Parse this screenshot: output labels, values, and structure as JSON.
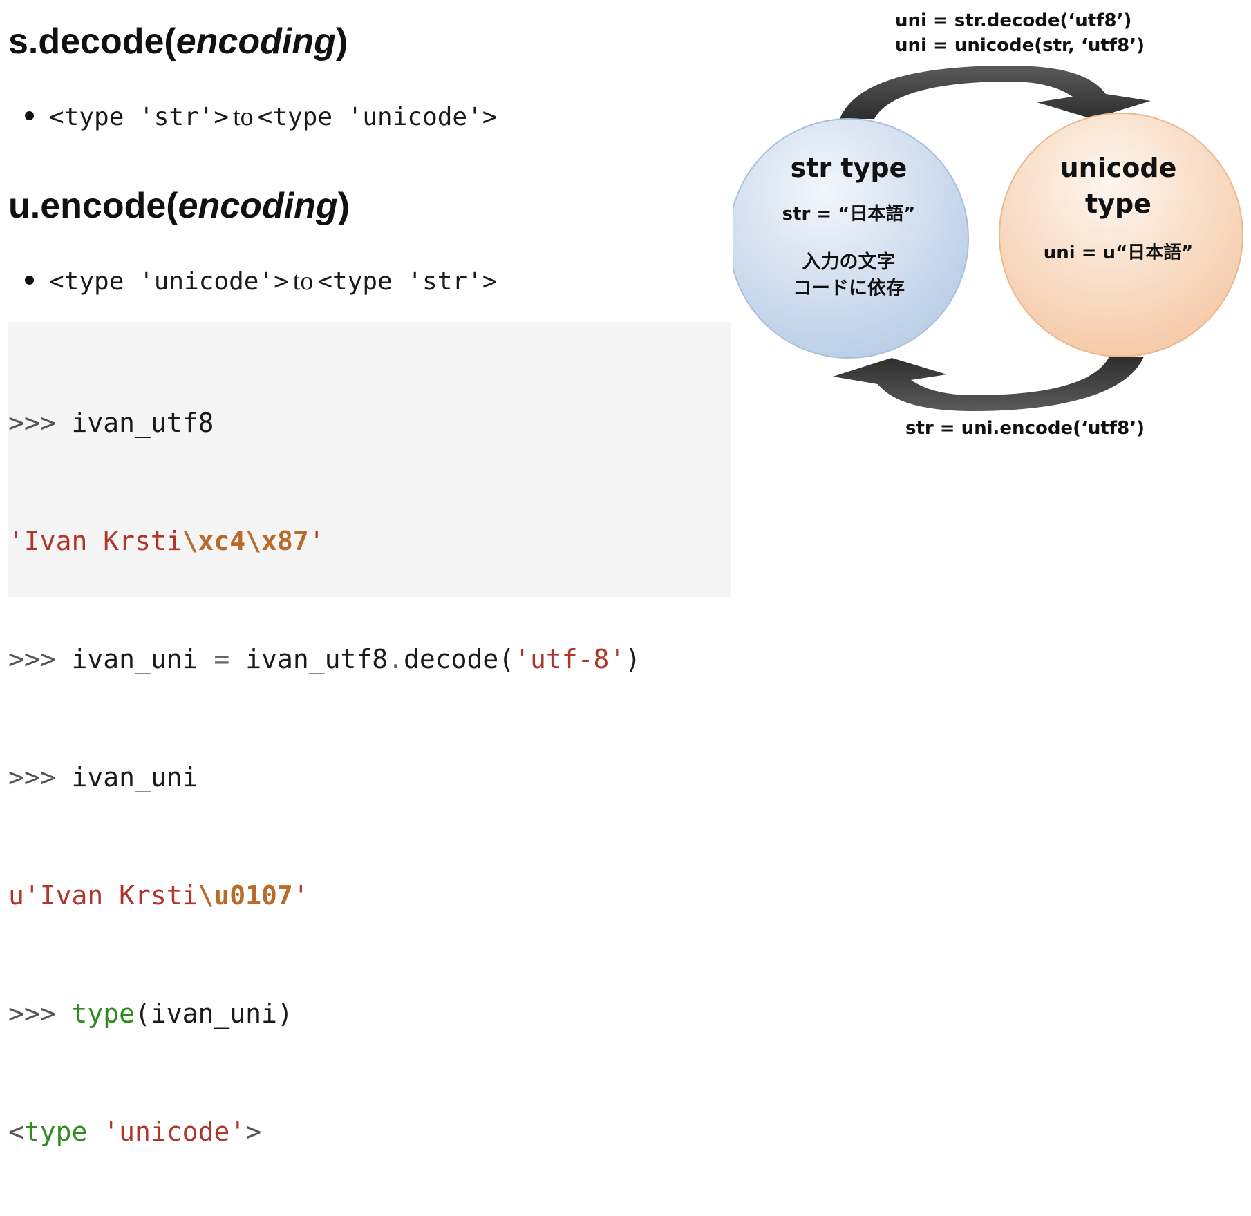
{
  "left": {
    "heading1": {
      "prefix": "s.decode(",
      "param": "encoding",
      "suffix": ")"
    },
    "bullet1": {
      "from": "<type 'str'>",
      "word": "to",
      "to": "<type 'unicode'>"
    },
    "heading2": {
      "prefix": "u.encode(",
      "param": "encoding",
      "suffix": ")"
    },
    "bullet2": {
      "from": "<type 'unicode'>",
      "word": "to",
      "to": "<type 'str'>"
    }
  },
  "code": {
    "l1": {
      "prompt": ">>> ",
      "text": "ivan_utf8"
    },
    "l2": {
      "open": "'Ivan Krsti",
      "esc": "\\xc4\\x87",
      "close": "'"
    },
    "l3": {
      "prompt": ">>> ",
      "a": "ivan_uni ",
      "eq": "=",
      "b": " ivan_utf8",
      "dot": ".",
      "c": "decode(",
      "s": "'utf-8'",
      "d": ")"
    },
    "l4": {
      "prompt": ">>> ",
      "text": "ivan_uni"
    },
    "l5": {
      "open": "u'Ivan Krsti",
      "esc": "\\u0107",
      "close": "'"
    },
    "l6": {
      "prompt": ">>> ",
      "kw": "type",
      "rest": "(ivan_uni)"
    },
    "l7": {
      "lt": "<",
      "kw": "type",
      "sp": " ",
      "s": "'unicode'",
      "gt": ">"
    }
  },
  "diagram": {
    "top_label_1": "uni = str.decode(‘utf8’)",
    "top_label_2": "uni = unicode(str, ‘utf8’)",
    "bottom_label": "str = uni.encode(‘utf8’)",
    "left_circle": {
      "title": "str type",
      "example": "str = “日本語”",
      "note_1": "入力の文字",
      "note_2": "コードに依存",
      "fill_top": "#f2f6fb",
      "fill_bottom": "#b9cde6"
    },
    "right_circle": {
      "title_1": "unicode",
      "title_2": "type",
      "example": "uni = u“日本語”",
      "fill_top": "#fdf6ef",
      "fill_bottom": "#f5c8a4"
    },
    "arrow_color": "#3a3a3a"
  }
}
